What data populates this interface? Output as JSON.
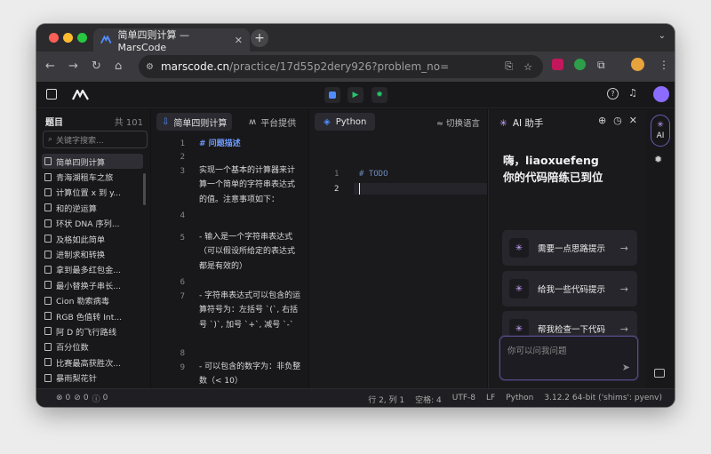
{
  "browser": {
    "tab_title": "简单四则计算 — MarsCode",
    "tab_close": "✕",
    "new_tab": "+",
    "url_host": "marscode.cn",
    "url_path": "/practice/17d55p2dery926?problem_no="
  },
  "colors": {
    "accent": "#4f8dff",
    "ai_purple": "#8b6cff",
    "run_green": "#27c46a"
  },
  "sidebar": {
    "title": "题目",
    "count": "共 101",
    "search_placeholder": "关键字搜索...",
    "items": [
      {
        "label": "简单四则计算"
      },
      {
        "label": "青海湖租车之旅"
      },
      {
        "label": "计算位置 x 到 y..."
      },
      {
        "label": "和的逆运算"
      },
      {
        "label": "环状 DNA 序列..."
      },
      {
        "label": "及格如此简单"
      },
      {
        "label": "进制求和转换"
      },
      {
        "label": "拿到最多红包金..."
      },
      {
        "label": "最小替换子串长..."
      },
      {
        "label": "Cion 勒索病毒"
      },
      {
        "label": "RGB 色值转 Int..."
      },
      {
        "label": "阿 D 的飞行路线"
      },
      {
        "label": "百分位数"
      },
      {
        "label": "比赛最高获胜次..."
      },
      {
        "label": "暴雨梨花针"
      }
    ]
  },
  "description": {
    "tab_problem": "简单四则计算",
    "tab_platform": "平台提供",
    "lines": [
      {
        "no": "1",
        "text": "# 问题描述"
      },
      {
        "no": "2",
        "text": ""
      },
      {
        "no": "3",
        "text": "实现一个基本的计算器来计算一个简单的字符串表达式的值。注意事项如下："
      },
      {
        "no": "4",
        "text": ""
      },
      {
        "no": "5",
        "text": "- 输入是一个字符串表达式（可以假设所给定的表达式都是有效的）"
      },
      {
        "no": "6",
        "text": ""
      },
      {
        "no": "7",
        "text": "- 字符串表达式可以包含的运算符号为：左括号 `(`, 右括号 `)`, 加号 `+`, 减号 `-`"
      },
      {
        "no": "8",
        "text": ""
      },
      {
        "no": "9",
        "text": "- 可以包含的数字为：非负整数（< 10）"
      }
    ]
  },
  "editor": {
    "language_tab": "Python",
    "switch_language": "切换语言",
    "lines": [
      {
        "no": "1",
        "text": "# TODO"
      },
      {
        "no": "2",
        "text": ""
      }
    ]
  },
  "ai": {
    "title": "AI 助手",
    "greeting_line1": "嗨，liaoxuefeng",
    "greeting_line2": "你的代码陪练已到位",
    "cards": [
      {
        "label": "需要一点思路提示"
      },
      {
        "label": "给我一些代码提示"
      },
      {
        "label": "帮我检查一下代码"
      }
    ],
    "input_placeholder": "你可以问我问题",
    "rail_label": "AI"
  },
  "status": {
    "errors": "0",
    "warnings": "0",
    "info": "0",
    "position": "行 2, 列 1",
    "spaces": "空格: 4",
    "encoding": "UTF-8",
    "eol": "LF",
    "language": "Python",
    "interpreter": "3.12.2 64-bit ('shims': pyenv)"
  }
}
